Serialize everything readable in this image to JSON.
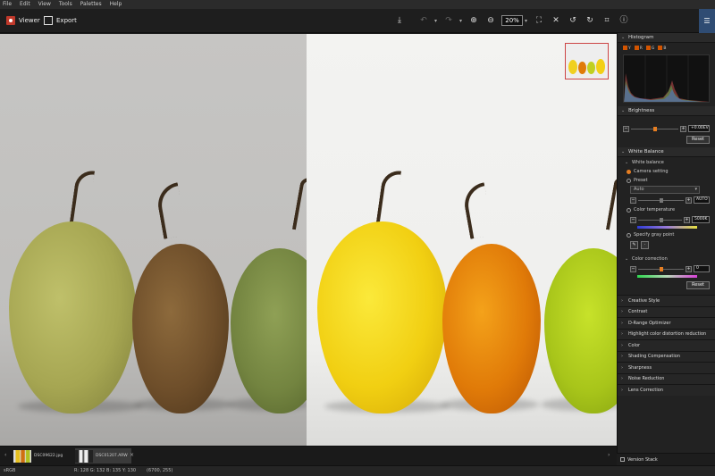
{
  "menu": [
    "File",
    "Edit",
    "View",
    "Tools",
    "Palettes",
    "Help"
  ],
  "toolbar": {
    "viewer_label": "Viewer",
    "export_label": "Export",
    "zoom_value": "20%"
  },
  "navigator": {},
  "sidebar": {
    "histogram": {
      "title": "Histogram",
      "channels": [
        "Y",
        "R",
        "G",
        "B"
      ]
    },
    "brightness": {
      "title": "Brightness",
      "value": "+0.00EV",
      "reset_label": "Reset",
      "level": 0.5
    },
    "white_balance": {
      "title": "White Balance",
      "sub_title": "White balance",
      "option_camera": "Camera setting",
      "option_preset": "Preset",
      "preset_value": "Auto",
      "preset_slider_value": "AUTO",
      "option_temperature": "Color temperature",
      "temperature_value": "5000K",
      "option_gray": "Specify gray point",
      "correction_title": "Color correction",
      "correction_value": "0",
      "reset_label": "Reset"
    },
    "collapsed_sections": [
      "Creative Style",
      "Contrast",
      "D-Range Optimizer",
      "Highlight color distortion reduction",
      "Color",
      "Shading Compensation",
      "Sharpness",
      "Noise Reduction",
      "Lens Correction"
    ]
  },
  "filmstrip": {
    "thumbs": [
      {
        "name": "DSC09622.jpg"
      },
      {
        "name": "DSC01207.ARW"
      }
    ]
  },
  "version_stack": "Version Stack",
  "status": {
    "colorspace": "sRGB",
    "rgb": "R: 128  G: 132  B: 135  Y: 130",
    "coords": "(6700, 255)"
  },
  "colors": {
    "accent": "#e67e22",
    "panel_toggle": "#2f4c73",
    "viewer_icon": "#c0392b"
  }
}
